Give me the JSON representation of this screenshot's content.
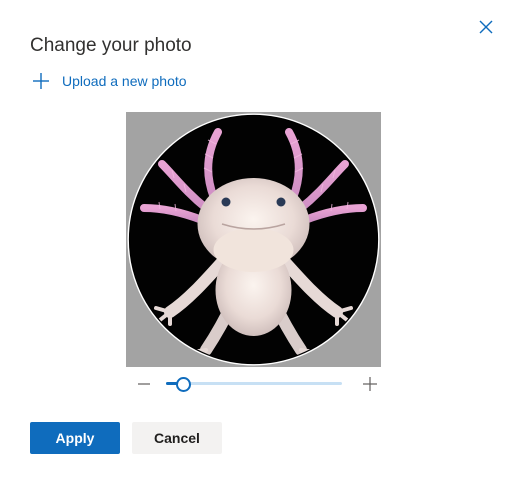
{
  "dialog": {
    "title": "Change your photo",
    "upload_label": "Upload a new photo",
    "apply_label": "Apply",
    "cancel_label": "Cancel"
  },
  "icons": {
    "close": "close-icon",
    "upload": "plus-icon",
    "zoom_out": "minus-icon",
    "zoom_in": "plus-icon"
  },
  "zoom": {
    "level_fraction": 0.1
  },
  "photo": {
    "subject": "axolotl"
  },
  "colors": {
    "accent": "#0f6cbd",
    "title_text": "#323130",
    "crop_backdrop": "#a3a3a3",
    "secondary_button": "#f3f2f1"
  }
}
